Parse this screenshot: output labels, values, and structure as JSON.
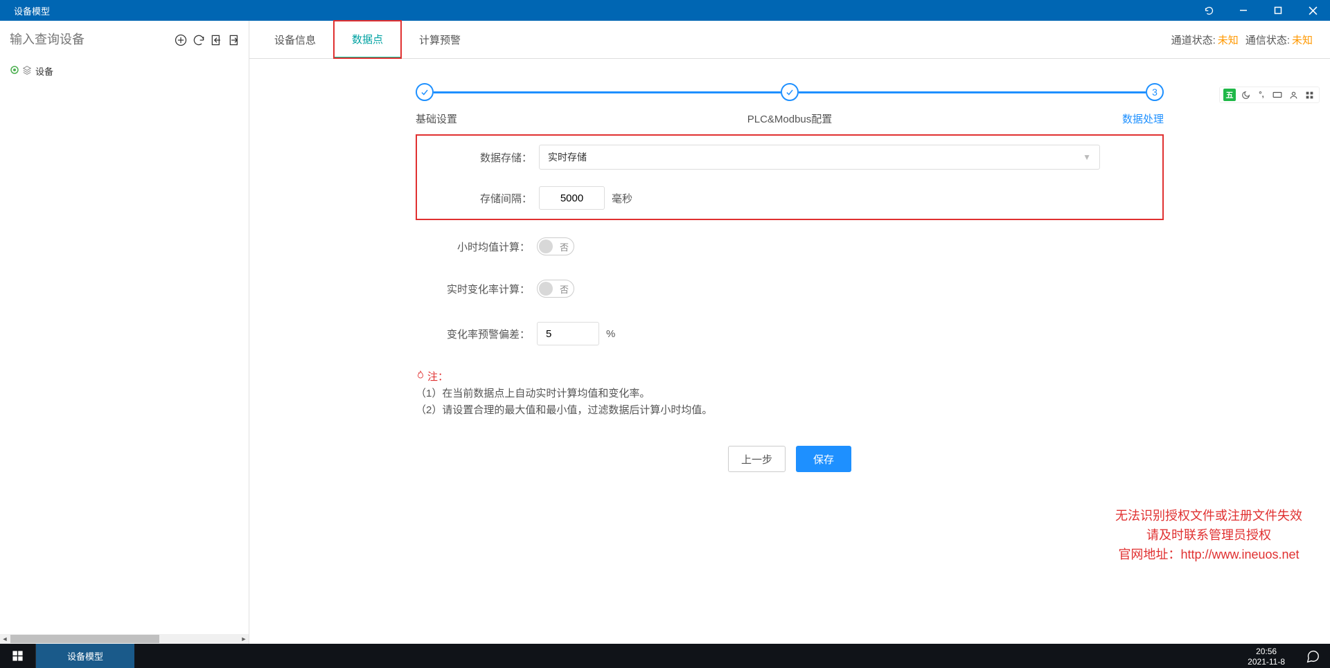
{
  "titlebar": {
    "title": "设备模型"
  },
  "sidebar": {
    "search_placeholder": "输入查询设备",
    "tree": {
      "root_label": "设备"
    }
  },
  "tabs": {
    "t1": "设备信息",
    "t2": "数据点",
    "t3": "计算预警"
  },
  "status": {
    "channel_label": "通道状态:",
    "channel_value": "未知",
    "comm_label": "通信状态:",
    "comm_value": "未知"
  },
  "float": {
    "badge": "五"
  },
  "stepper": {
    "step1": "基础设置",
    "step2": "PLC&Modbus配置",
    "step3": "数据处理",
    "step3_num": "3"
  },
  "form": {
    "storage_label": "数据存储：",
    "storage_value": "实时存储",
    "interval_label": "存储间隔：",
    "interval_value": "5000",
    "interval_unit": "毫秒",
    "hourly_label": "小时均值计算：",
    "hourly_value": "否",
    "rate_label": "实时变化率计算：",
    "rate_value": "否",
    "deviation_label": "变化率预警偏差：",
    "deviation_value": "5",
    "deviation_unit": "%"
  },
  "notes": {
    "title": "注：",
    "n1": "（1）在当前数据点上自动实时计算均值和变化率。",
    "n2": "（2）请设置合理的最大值和最小值，过滤数据后计算小时均值。"
  },
  "actions": {
    "prev": "上一步",
    "save": "保存"
  },
  "warning": {
    "line1": "无法识别授权文件或注册文件失效",
    "line2": "请及时联系管理员授权",
    "line3_prefix": "官网地址：",
    "line3_url": "http://www.ineuos.net"
  },
  "taskbar": {
    "app": "设备模型",
    "time": "20:56",
    "date": "2021-11-8"
  }
}
